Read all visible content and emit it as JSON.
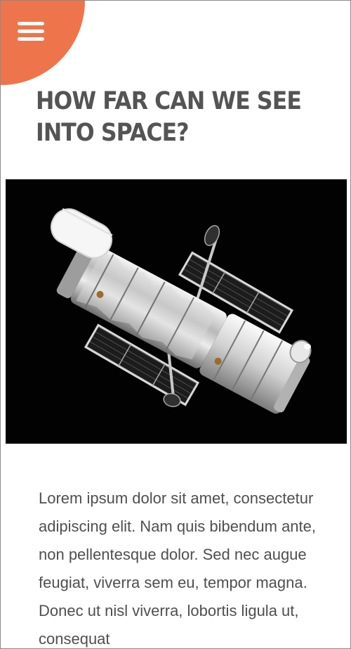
{
  "header": {
    "menu_icon": "hamburger-menu-icon",
    "accent_color": "#ee754b"
  },
  "article": {
    "title": "HOW FAR CAN WE SEE INTO SPACE?",
    "image_subject": "hubble-space-telescope",
    "body": "Lorem ipsum dolor sit amet, consectetur adipiscing elit. Nam quis bibendum ante, non pellentesque dolor. Sed nec augue feugiat, viverra sem eu, tempor magna. Donec ut nisl viverra, lobortis ligula ut, consequat"
  }
}
